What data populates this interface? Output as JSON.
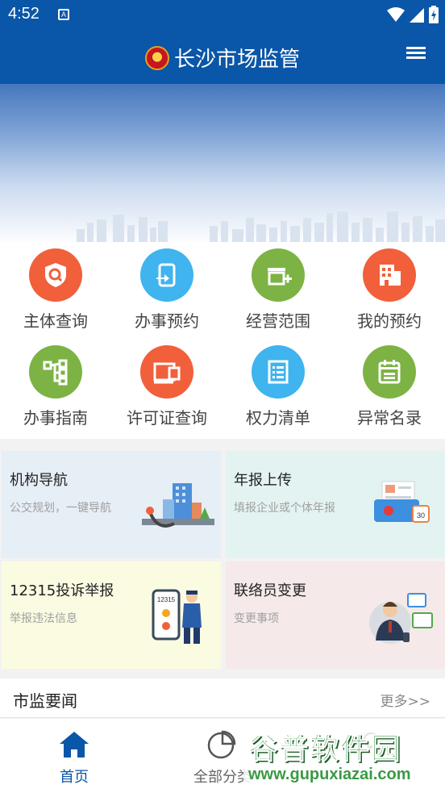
{
  "status_bar": {
    "time": "4:52",
    "notification_glyph": "A"
  },
  "app_bar": {
    "title": "长沙市场监管"
  },
  "grid": [
    {
      "label": "主体查询",
      "icon": "shield-search-icon",
      "color": "#f15f3b"
    },
    {
      "label": "办事预约",
      "icon": "phone-arrow-icon",
      "color": "#3fb4ef"
    },
    {
      "label": "经营范围",
      "icon": "store-plus-icon",
      "color": "#7db244"
    },
    {
      "label": "我的预约",
      "icon": "building-icon",
      "color": "#f15f3b"
    },
    {
      "label": "办事指南",
      "icon": "flowchart-icon",
      "color": "#7db244"
    },
    {
      "label": "许可证查询",
      "icon": "license-card-icon",
      "color": "#f15f3b"
    },
    {
      "label": "权力清单",
      "icon": "list-document-icon",
      "color": "#3fb4ef"
    },
    {
      "label": "异常名录",
      "icon": "calendar-list-icon",
      "color": "#7db244"
    }
  ],
  "cards": [
    {
      "title": "机构导航",
      "subtitle": "公交规划，一键导航",
      "bg": "#e6eef6",
      "icon": "city-map-illustration"
    },
    {
      "title": "年报上传",
      "subtitle": "填报企业或个体年报",
      "bg": "#e3f3f1",
      "icon": "annual-report-illustration"
    },
    {
      "title": "12315投诉举报",
      "subtitle": "举报违法信息",
      "bg": "#fbfbe2",
      "icon": "phone-officer-illustration",
      "phone_text": "12315"
    },
    {
      "title": "联络员变更",
      "subtitle": "变更事项",
      "bg": "#f5e9ea",
      "icon": "liaison-person-illustration"
    }
  ],
  "news": {
    "title": "市监要闻",
    "more": "更多>>"
  },
  "tabs": [
    {
      "label": "首页",
      "icon": "home-icon",
      "active": true
    },
    {
      "label": "全部分类",
      "icon": "pie-chart-icon",
      "active": false
    },
    {
      "label": "",
      "icon": "user-icon",
      "active": false
    }
  ],
  "watermark": {
    "main": "谷普软件园",
    "url": "www.gupuxiazai.com"
  },
  "colors": {
    "primary": "#0a56a8",
    "orange": "#f15f3b",
    "blue": "#3fb4ef",
    "green": "#7db244"
  }
}
